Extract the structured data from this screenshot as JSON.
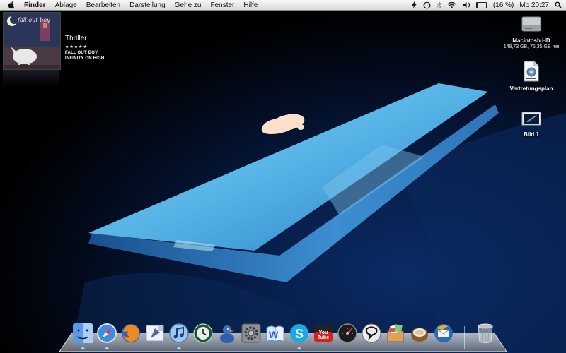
{
  "menubar": {
    "apple_icon": "apple-logo-icon",
    "items": [
      "Finder",
      "Ablage",
      "Bearbeiten",
      "Darstellung",
      "Gehe zu",
      "Fenster",
      "Hilfe"
    ],
    "status": {
      "icons": [
        "flash-icon",
        "time-machine-icon",
        "bluetooth-icon",
        "wifi-icon",
        "volume-icon",
        "battery-icon",
        "spotlight-icon"
      ],
      "battery_text": "(16 %)",
      "battery_level": 0.16,
      "clock": "Mo 20:27"
    }
  },
  "now_playing": {
    "album_art_text": "fall out boy",
    "title": "Thriller",
    "rating": "★★★★★",
    "artist": "FALL OUT BOY",
    "album": "INFINITY ON HIGH"
  },
  "desktop_icons": [
    {
      "label": "Macintosh HD",
      "sub": "148,73 GB, 75,35 GB frei",
      "icon": "hard-drive-icon"
    },
    {
      "label": "Vertretungsplan",
      "sub": "",
      "icon": "archive-file-icon"
    },
    {
      "label": "Bild 1",
      "sub": "",
      "icon": "screenshot-image-icon"
    }
  ],
  "dock": {
    "items": [
      "finder",
      "safari",
      "firefox",
      "mail",
      "itunes",
      "time-machine",
      "adium-duck",
      "system-preferences",
      "word",
      "skype",
      "youtube",
      "dashboard",
      "pidgin",
      "photo-box",
      "coconut-battery",
      "thunderbird"
    ],
    "trash": "trash",
    "youtube_label": "You Tube"
  }
}
